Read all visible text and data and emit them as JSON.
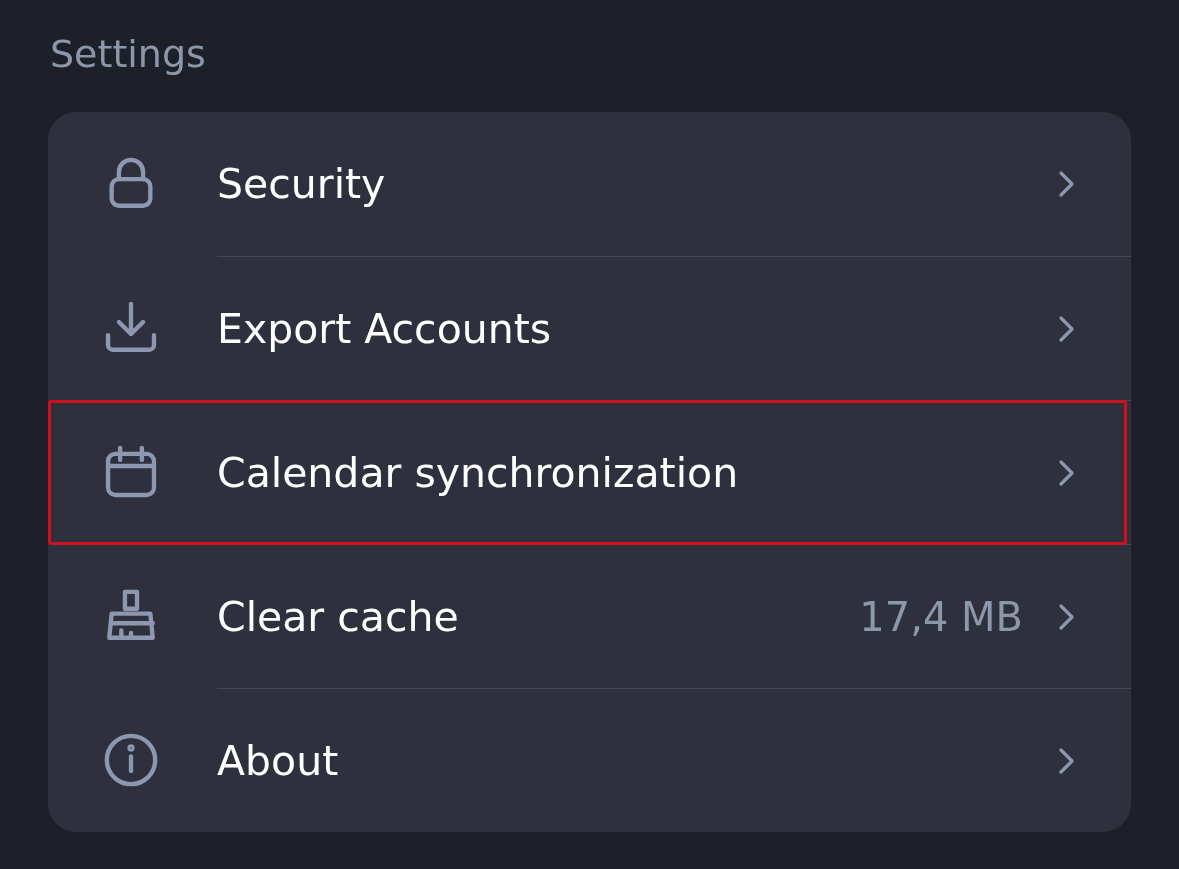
{
  "title": "Settings",
  "items": [
    {
      "label": "Security",
      "highlighted": false
    },
    {
      "label": "Export Accounts",
      "highlighted": false
    },
    {
      "label": "Calendar synchronization",
      "highlighted": true
    },
    {
      "label": "Clear cache",
      "value": "17,4 MB",
      "highlighted": false
    },
    {
      "label": "About",
      "highlighted": false
    }
  ]
}
